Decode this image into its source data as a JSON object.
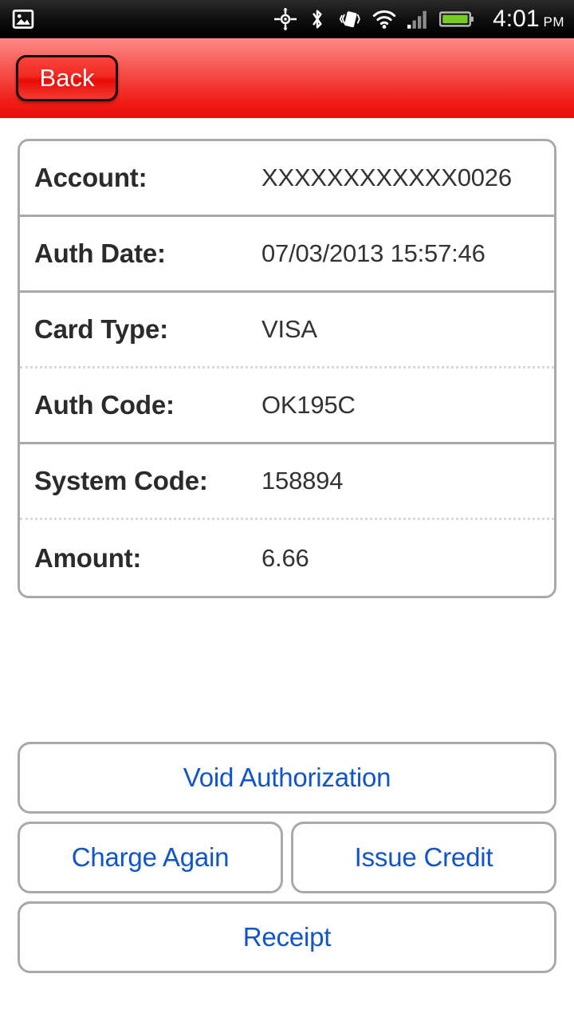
{
  "statusbar": {
    "left_icons": [
      {
        "name": "photo-gallery-icon",
        "glyph": "photo"
      }
    ],
    "right_icons": [
      {
        "name": "gps-icon",
        "glyph": "gps"
      },
      {
        "name": "bluetooth-icon",
        "glyph": "bluetooth"
      },
      {
        "name": "vibrate-mode-icon",
        "glyph": "vibrate"
      },
      {
        "name": "wifi-icon",
        "glyph": "wifi"
      },
      {
        "name": "cellular-signal-icon",
        "glyph": "signal"
      },
      {
        "name": "battery-icon",
        "glyph": "battery"
      }
    ],
    "time": "4:01",
    "ampm": "PM",
    "battery_color": "#77cc22",
    "background_color": "#000000"
  },
  "header": {
    "back_label": "Back",
    "gradient_top": "#fb8a87",
    "gradient_bottom": "#e90f08"
  },
  "details": {
    "rows": [
      {
        "label": "Account:",
        "value": "XXXXXXXXXXXX0026"
      },
      {
        "label": "Auth Date:",
        "value": "07/03/2013 15:57:46"
      },
      {
        "label": "Card Type:",
        "value": "VISA"
      },
      {
        "label": "Auth Code:",
        "value": "OK195C"
      },
      {
        "label": "System Code:",
        "value": "158894"
      },
      {
        "label": "Amount:",
        "value": "6.66"
      }
    ]
  },
  "actions": {
    "void_authorization": "Void Authorization",
    "charge_again": "Charge Again",
    "issue_credit": "Issue Credit",
    "receipt": "Receipt",
    "link_color": "#1155cc",
    "border_color": "#a9a9a9"
  }
}
